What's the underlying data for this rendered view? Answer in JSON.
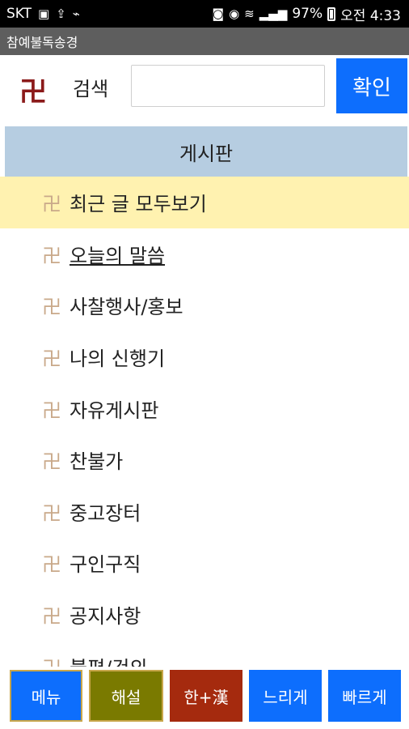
{
  "status": {
    "carrier": "SKT",
    "battery_percent": "97%",
    "time_label": "오전 4:33"
  },
  "app": {
    "title": "참예불독송경"
  },
  "search": {
    "logo_glyph": "卍",
    "label": "검색",
    "placeholder": "",
    "value": "",
    "confirm_label": "확인"
  },
  "board": {
    "header": "게시판",
    "items": [
      {
        "label": "최근 글 모두보기"
      },
      {
        "label": "오늘의 말씀"
      },
      {
        "label": "사찰행사/홍보"
      },
      {
        "label": "나의 신행기"
      },
      {
        "label": "자유게시판"
      },
      {
        "label": "찬불가"
      },
      {
        "label": "중고장터"
      },
      {
        "label": "구인구직"
      },
      {
        "label": "공지사항"
      },
      {
        "label": "불편/건의"
      }
    ]
  },
  "bottom_buttons": {
    "menu": "메뉴",
    "commentary": "해설",
    "hangul_hanja": "한+漢",
    "slower": "느리게",
    "faster": "빠르게"
  },
  "colors": {
    "accent_blue": "#0d6efd",
    "header_blue": "#b6cde1",
    "highlight_yellow": "#fff2b0",
    "olive": "#7a7a00",
    "red": "#a52a0e"
  },
  "icons": {
    "manji": "卍"
  }
}
